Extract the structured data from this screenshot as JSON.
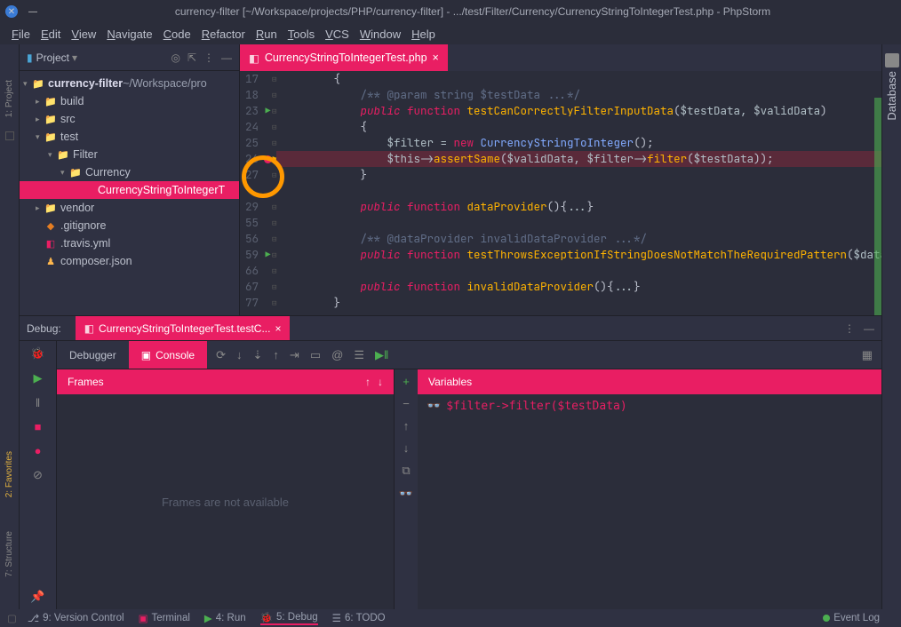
{
  "window": {
    "title": "currency-filter [~/Workspace/projects/PHP/currency-filter] - .../test/Filter/Currency/CurrencyStringToIntegerTest.php - PhpStorm"
  },
  "menu": [
    "File",
    "Edit",
    "View",
    "Navigate",
    "Code",
    "Refactor",
    "Run",
    "Tools",
    "VCS",
    "Window",
    "Help"
  ],
  "project": {
    "header": "Project",
    "root_name": "currency-filter",
    "root_path": "~/Workspace/pro",
    "nodes": [
      {
        "indent": 1,
        "arrow": "▸",
        "icon": "📁",
        "color": "c-orange",
        "label": "build"
      },
      {
        "indent": 1,
        "arrow": "▸",
        "icon": "📁",
        "color": "c-blue",
        "label": "src"
      },
      {
        "indent": 1,
        "arrow": "▾",
        "icon": "📁",
        "color": "c-blue",
        "label": "test"
      },
      {
        "indent": 2,
        "arrow": "▾",
        "icon": "📁",
        "color": "c-blue",
        "label": "Filter"
      },
      {
        "indent": 3,
        "arrow": "▾",
        "icon": "📁",
        "color": "c-blue",
        "label": "Currency"
      },
      {
        "indent": 4,
        "arrow": "",
        "icon": "◧",
        "color": "c-pink",
        "label": "CurrencyStringToIntegerT",
        "sel": true
      },
      {
        "indent": 1,
        "arrow": "▸",
        "icon": "📁",
        "color": "c-green",
        "label": "vendor"
      },
      {
        "indent": 1,
        "arrow": "",
        "icon": "◆",
        "color": "c-orange",
        "label": ".gitignore"
      },
      {
        "indent": 1,
        "arrow": "",
        "icon": "◧",
        "color": "c-pink",
        "label": ".travis.yml"
      },
      {
        "indent": 1,
        "arrow": "",
        "icon": "♟",
        "color": "c-yellow",
        "label": "composer.json"
      }
    ]
  },
  "editor": {
    "tab_name": "CurrencyStringToIntegerTest.php",
    "lines": [
      {
        "n": 17,
        "html": "{",
        "indent": 2
      },
      {
        "n": 18,
        "html": "<span class='cm'>/** @param string $testData ...*/</span>",
        "indent": 3
      },
      {
        "n": 23,
        "run": true,
        "html": "<span class='kw'>public</span> <span class='def'>function</span> <span class='fn'>testCanCorrectlyFilterInputData</span><span class='txt'>(</span><span class='var'>$testData</span><span class='op'>, </span><span class='var'>$validData</span><span class='txt'>)</span>",
        "indent": 3
      },
      {
        "n": 24,
        "html": "{",
        "indent": 3
      },
      {
        "n": 25,
        "html": "<span class='var'>$filter</span> <span class='op'>=</span> <span class='def'>new</span> <span class='ty'>CurrencyStringToInteger</span><span class='txt'>();</span>",
        "indent": 4
      },
      {
        "n": 26,
        "bp": true,
        "html": "<span class='var'>$this</span><span class='op'>-></span><span class='fn'>assertSame</span><span class='txt'>(</span><span class='var'>$validData</span><span class='op'>, </span><span class='var'>$filter</span><span class='op'>-></span><span class='fn'>filter</span><span class='txt'>(</span><span class='var'>$testData</span><span class='txt'>));</span>",
        "indent": 4
      },
      {
        "n": 27,
        "html": "}",
        "indent": 3
      },
      {
        "n": "",
        "html": "",
        "indent": 0
      },
      {
        "n": 29,
        "html": "<span class='kw'>public</span> <span class='def'>function</span> <span class='fn'>dataProvider</span><span class='txt'>()</span><span class='txt'>{</span><span class='op'>...</span><span class='txt'>}</span>",
        "indent": 3
      },
      {
        "n": 55,
        "html": "",
        "indent": 0
      },
      {
        "n": 56,
        "html": "<span class='cm'>/** @dataProvider invalidDataProvider ...*/</span>",
        "indent": 3
      },
      {
        "n": 59,
        "run": true,
        "html": "<span class='kw'>public</span> <span class='def'>function</span> <span class='fn'>testThrowsExceptionIfStringDoesNotMatchTheRequiredPattern</span><span class='txt'>(</span><span class='var'>$data</span><span class='txt'>)</span><span class='txt'>{</span><span class='op'>...</span><span class='txt'>}</span>",
        "indent": 3
      },
      {
        "n": 66,
        "html": "",
        "indent": 0
      },
      {
        "n": 67,
        "html": "<span class='kw'>public</span> <span class='def'>function</span> <span class='fn'>invalidDataProvider</span><span class='txt'>()</span><span class='txt'>{</span><span class='op'>...</span><span class='txt'>}</span>",
        "indent": 3
      },
      {
        "n": 77,
        "html": "}",
        "indent": 2
      }
    ]
  },
  "debug": {
    "header": "Debug:",
    "tab_label": "CurrencyStringToIntegerTest.testC...",
    "tabs": {
      "debugger": "Debugger",
      "console": "Console"
    },
    "frames_label": "Frames",
    "frames_empty": "Frames are not available",
    "vars_label": "Variables",
    "watch_expr": "$filter->filter($testData)"
  },
  "left_gutter": {
    "project": "1: Project",
    "favorites": "2: Favorites",
    "structure": "7: Structure"
  },
  "right_gutter": {
    "database": "Database"
  },
  "status": {
    "vcs": "9: Version Control",
    "terminal": "Terminal",
    "run": "4: Run",
    "debug": "5: Debug",
    "todo": "6: TODO",
    "event": "Event Log"
  }
}
